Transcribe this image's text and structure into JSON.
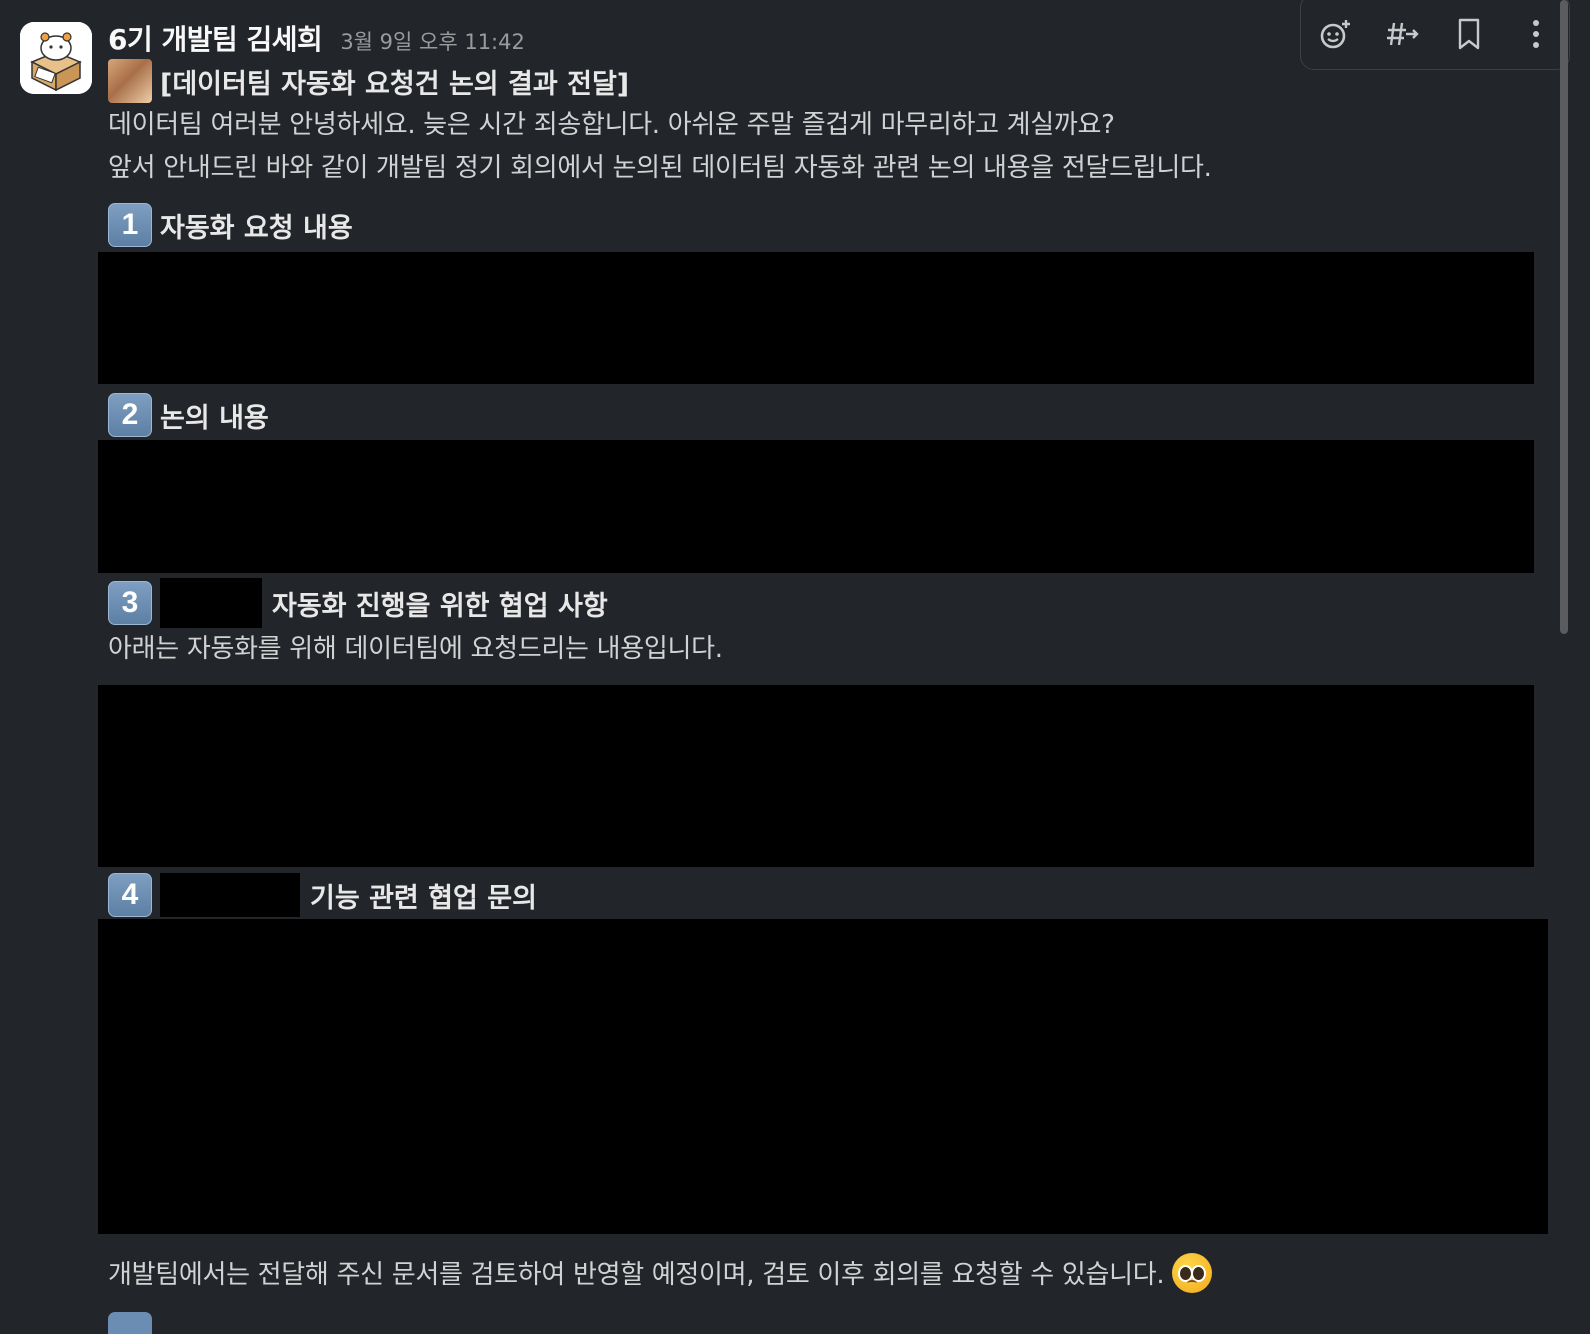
{
  "message": {
    "sender": "6기 개발팀 김세희",
    "timestamp": "3월 9일 오후 11:42",
    "title": "[데이터팀 자동화 요청건 논의 결과 전달]",
    "intro_line1": "데이터팀 여러분 안녕하세요. 늦은 시간 죄송합니다. 아쉬운 주말 즐겁게 마무리하고 계실까요?",
    "intro_line2": "앞서 안내드린 바와 같이 개발팀 정기 회의에서 논의된 데이터팀 자동화 관련 논의 내용을 전달드립니다.",
    "sections": [
      {
        "number": "1",
        "heading": "자동화 요청 내용"
      },
      {
        "number": "2",
        "heading": "논의 내용"
      },
      {
        "number": "3",
        "heading": "자동화 진행을 위한 협업 사항",
        "body": "아래는 자동화를 위해 데이터팀에 요청드리는 내용입니다."
      },
      {
        "number": "4",
        "heading": "기능 관련 협업 문의"
      }
    ],
    "closing": "개발팀에서는 전달해 주신 문서를 검토하여 반영할 예정이며, 검토 이후 회의를 요청할 수 있습니다."
  },
  "toolbar": {
    "icons": [
      "add-reaction-icon",
      "forward-to-channel-icon",
      "bookmark-icon",
      "more-actions-icon"
    ]
  },
  "colors": {
    "background": "#222529",
    "text": "#d1d2d3",
    "timestamp": "#9a9b9d",
    "redaction": "#000000",
    "badge": "#6b8db3"
  }
}
